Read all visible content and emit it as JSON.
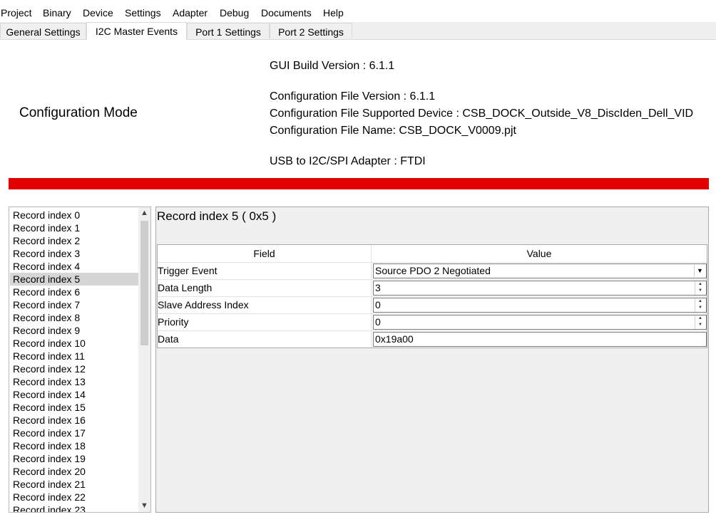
{
  "menu": [
    "Project",
    "Binary",
    "Device",
    "Settings",
    "Adapter",
    "Debug",
    "Documents",
    "Help"
  ],
  "tabs": [
    {
      "label": "General Settings",
      "active": false
    },
    {
      "label": "I2C Master Events",
      "active": true
    },
    {
      "label": "Port 1 Settings",
      "active": false
    },
    {
      "label": "Port 2 Settings",
      "active": false
    }
  ],
  "header": {
    "mode_title": "Configuration Mode",
    "gui_build_version": "GUI Build Version : 6.1.1",
    "config_file_version": "Configuration File Version : 6.1.1",
    "config_supported_device": "Configuration File Supported Device : CSB_DOCK_Outside_V8_DiscIden_Dell_VID",
    "config_file_name": "Configuration File Name: CSB_DOCK_V0009.pjt",
    "usb_adapter": "USB to I2C/SPI Adapter : FTDI",
    "status_color": "#e00000"
  },
  "records": {
    "selected_index": 5,
    "items": [
      "Record index 0",
      "Record index 1",
      "Record index 2",
      "Record index 3",
      "Record index 4",
      "Record index 5",
      "Record index 6",
      "Record index 7",
      "Record index 8",
      "Record index 9",
      "Record index 10",
      "Record index 11",
      "Record index 12",
      "Record index 13",
      "Record index 14",
      "Record index 15",
      "Record index 16",
      "Record index 17",
      "Record index 18",
      "Record index 19",
      "Record index 20",
      "Record index 21",
      "Record index 22",
      "Record index 23"
    ],
    "scroll_up_icon": "chevron-up-icon",
    "scroll_down_icon": "chevron-down-icon"
  },
  "detail": {
    "title": "Record index 5  ( 0x5 )",
    "columns": {
      "field": "Field",
      "value": "Value"
    },
    "rows": [
      {
        "field": "Trigger Event",
        "value": "Source PDO 2 Negotiated",
        "editor": "dropdown"
      },
      {
        "field": "Data Length",
        "value": "3",
        "editor": "spinner"
      },
      {
        "field": "Slave Address Index",
        "value": "0",
        "editor": "spinner"
      },
      {
        "field": "Priority",
        "value": "0",
        "editor": "spinner"
      },
      {
        "field": "Data",
        "value": "0x19a00",
        "editor": "text"
      }
    ]
  }
}
